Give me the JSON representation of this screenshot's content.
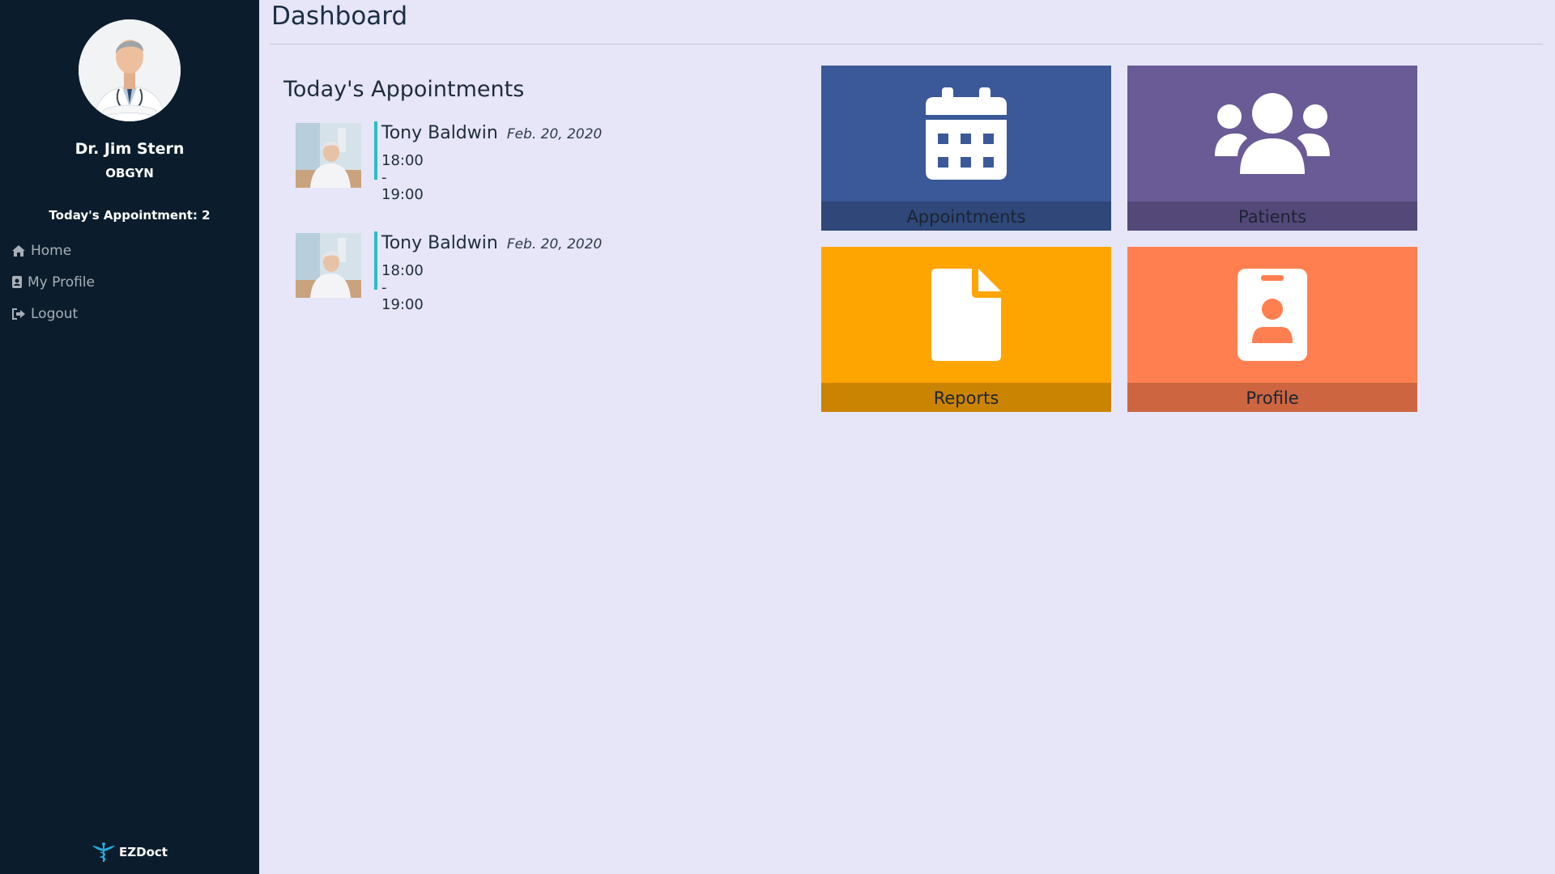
{
  "sidebar": {
    "doctor_name": "Dr. Jim Stern",
    "specialty": "OBGYN",
    "appointment_count_text": "Today's Appointment: 2",
    "nav": [
      {
        "label": "Home",
        "icon": "home-icon"
      },
      {
        "label": "My Profile",
        "icon": "id-badge-icon"
      },
      {
        "label": "Logout",
        "icon": "logout-icon"
      }
    ],
    "brand": "EZDoct"
  },
  "header": {
    "title": "Dashboard"
  },
  "appointments": {
    "title": "Today's Appointments",
    "items": [
      {
        "patient": "Tony Baldwin",
        "date": "Feb. 20, 2020",
        "time": "18:00 - 19:00"
      },
      {
        "patient": "Tony Baldwin",
        "date": "Feb. 20, 2020",
        "time": "18:00 - 19:00"
      }
    ]
  },
  "tiles": [
    {
      "label": "Appointments",
      "icon": "calendar-icon",
      "color": "#3b5998"
    },
    {
      "label": "Patients",
      "icon": "users-icon",
      "color": "#6a5a96"
    },
    {
      "label": "Reports",
      "icon": "file-icon",
      "color": "#fea502"
    },
    {
      "label": "Profile",
      "icon": "id-badge-icon",
      "color": "#ff7f50"
    }
  ]
}
